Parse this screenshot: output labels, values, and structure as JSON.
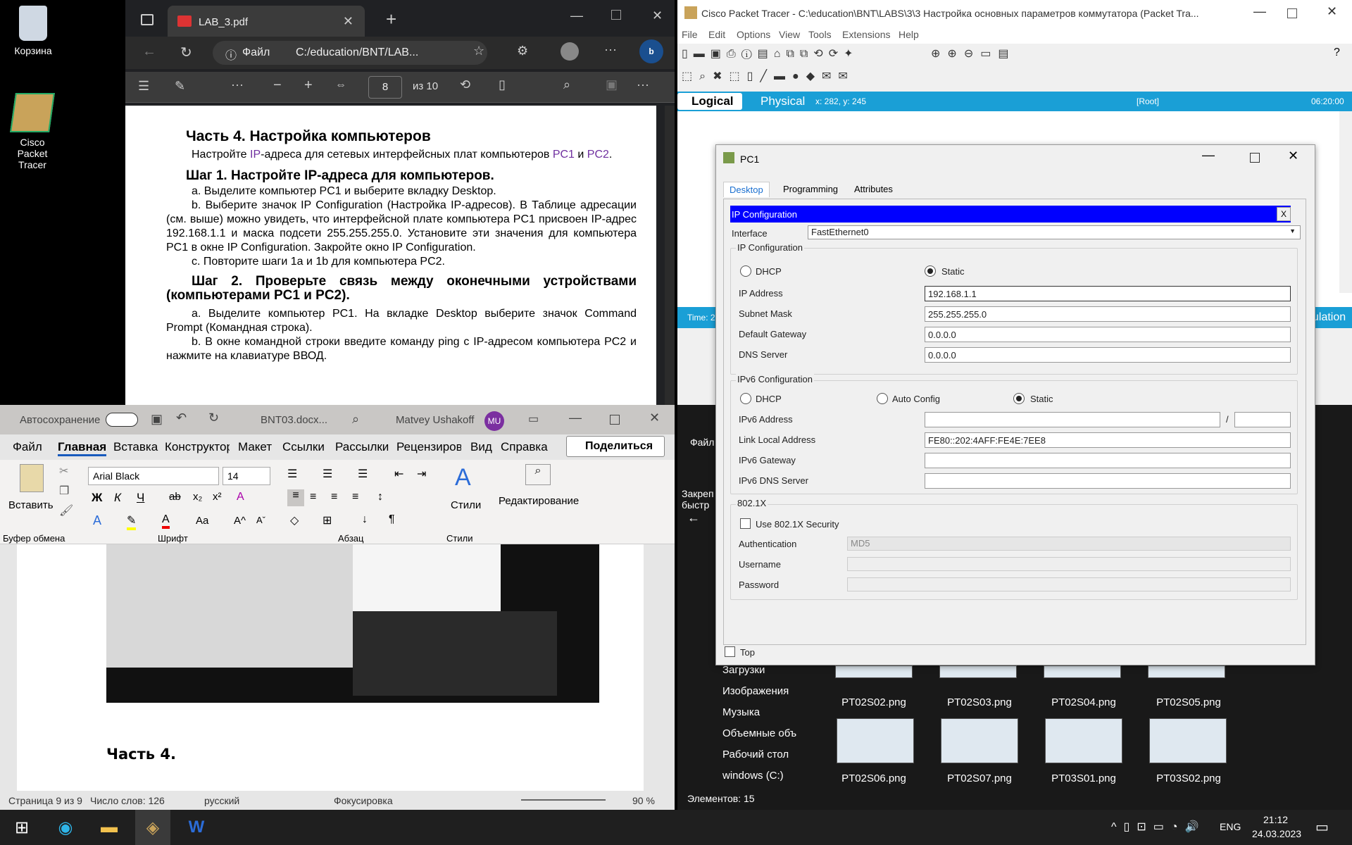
{
  "desktop": {
    "icons": [
      {
        "label": "Корзина"
      },
      {
        "label": "Cisco Packet Tracer"
      }
    ]
  },
  "edge": {
    "tab_title": "LAB_3.pdf",
    "file_label": "Файл",
    "address": "C:/education/BNT/LAB...",
    "page_current": "8",
    "page_total": "из 10"
  },
  "pdf": {
    "h1": "Часть 4. Настройка компьютеров",
    "p1a": "Настройте ",
    "p1ip": "IP",
    "p1b": "-адреса для сетевых интерфейсных плат компьютеров ",
    "p1pc1": "PC1",
    "p1c": " и ",
    "p1pc2": "PC2",
    "p1d": ".",
    "h2": "Шаг 1. Настройте IP-адреса для компьютеров.",
    "a": "a. Выделите компьютер PC1 и выберите вкладку Desktop.",
    "b": "b. Выберите значок IP Configuration (Настройка IP-адресов). В Таблице адресации (см. выше) можно увидеть, что интерфейсной плате компьютера PC1 присвоен IP-адрес 192.168.1.1 и маска подсети 255.255.255.0. Установите эти значения для компьютера PC1 в окне IP Configuration. Закройте окно IP Configuration.",
    "c": "c. Повторите шаги 1a и 1b для компьютера PC2.",
    "h3": "Шаг 2. Проверьте связь между оконечными устройствами (компьютерами PC1 и PC2).",
    "a2": "a. Выделите компьютер PC1. На вкладке Desktop выберите значок Command Prompt (Командная строка).",
    "b2": "b. В окне командной строки введите команду ping с IP-адресом компьютера PC2 и нажмите на клавиатуре ВВОД."
  },
  "word": {
    "autosave": "Автосохранение",
    "filename": "BNT03.docx...",
    "user": "Matvey Ushakoff",
    "initials": "MU",
    "menu": [
      "Файл",
      "Главная",
      "Вставка",
      "Конструктор",
      "Макет",
      "Ссылки",
      "Рассылки",
      "Рецензиров",
      "Вид",
      "Справка"
    ],
    "share": "Поделиться",
    "font": "Arial Black",
    "size": "14",
    "paste": "Вставить",
    "styles": "Стили",
    "editing": "Редактирование",
    "groups": [
      "Буфер обмена",
      "Шрифт",
      "Абзац",
      "Стили"
    ],
    "doc_heading": "Часть 4.",
    "status": {
      "page": "Страница 9 из 9",
      "words": "Число слов: 126",
      "lang": "русский",
      "focus": "Фокусировка",
      "zoom": "90 %"
    }
  },
  "pt": {
    "title": "Cisco Packet Tracer - C:\\education\\BNT\\LABS\\3\\3 Настройка основных параметров коммутатора (Packet Tra...",
    "menu": [
      "File",
      "Edit",
      "Options",
      "View",
      "Tools",
      "Extensions",
      "Help"
    ],
    "logical": "Logical",
    "physical": "Physical",
    "coords": "x: 282, y: 245",
    "root": "[Root]",
    "time": "06:20:00",
    "time_label": "Time: 2",
    "sim_label": "ulation"
  },
  "dialog": {
    "title": "PC1",
    "tabs": [
      "Desktop",
      "Programming",
      "Attributes"
    ],
    "header": "IP Configuration",
    "close": "X",
    "interface_label": "Interface",
    "interface_value": "FastEthernet0",
    "ipv4_group": "IP Configuration",
    "dhcp": "DHCP",
    "static": "Static",
    "ip_label": "IP Address",
    "ip": "192.168.1.1",
    "mask_label": "Subnet Mask",
    "mask": "255.255.255.0",
    "gw_label": "Default Gateway",
    "gw": "0.0.0.0",
    "dns_label": "DNS Server",
    "dns": "0.0.0.0",
    "ipv6_group": "IPv6 Configuration",
    "dhcp6": "DHCP",
    "auto": "Auto Config",
    "static6": "Static",
    "ipv6_label": "IPv6 Address",
    "ipv6": "",
    "slash": "/",
    "prefix": "",
    "lla_label": "Link Local Address",
    "lla": "FE80::202:4AFF:FE4E:7EE8",
    "gw6_label": "IPv6 Gateway",
    "gw6": "",
    "dns6_label": "IPv6 DNS Server",
    "dns6": "",
    "dot1x_group": "802.1X",
    "use8021x": "Use 802.1X Security",
    "auth_label": "Authentication",
    "auth": "MD5",
    "user_label": "Username",
    "pass_label": "Password",
    "top": "Top"
  },
  "explorer": {
    "file_label": "Файл",
    "quick": "Закреп быстр",
    "nav": [
      "Загрузки",
      "Изображения",
      "Музыка",
      "Объемные объ",
      "Рабочий стол",
      "windows (C:)"
    ],
    "files": [
      "PT02S02.png",
      "PT02S03.png",
      "PT02S04.png",
      "PT02S05.png",
      "PT02S06.png",
      "PT02S07.png",
      "PT03S01.png",
      "PT03S02.png"
    ],
    "count": "Элементов: 15"
  },
  "taskbar": {
    "lang": "ENG",
    "time": "21:12",
    "date": "24.03.2023"
  }
}
